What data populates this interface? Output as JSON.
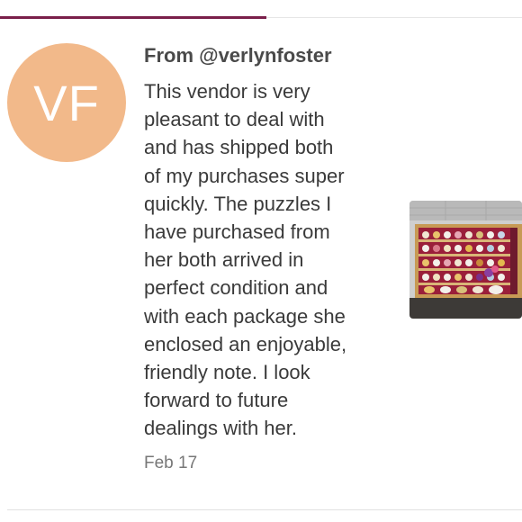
{
  "progress": {
    "fraction": 0.51,
    "color": "#7a1f4a"
  },
  "comment": {
    "avatar_initials": "VF",
    "avatar_color": "#f2b98a",
    "author_line": "From @verlynfoster",
    "body_lines": [
      "This vendor is very",
      "pleasant to deal with",
      "and has shipped both",
      "of my purchases super",
      "quickly. The puzzles I",
      "have purchased from",
      "her both arrived in",
      "perfect condition and",
      "with each package she",
      "enclosed an enjoyable,",
      "friendly note. I look",
      "forward to future",
      "dealings with her."
    ],
    "date": "Feb 17",
    "image_icon": "puzzle-box-photo"
  }
}
